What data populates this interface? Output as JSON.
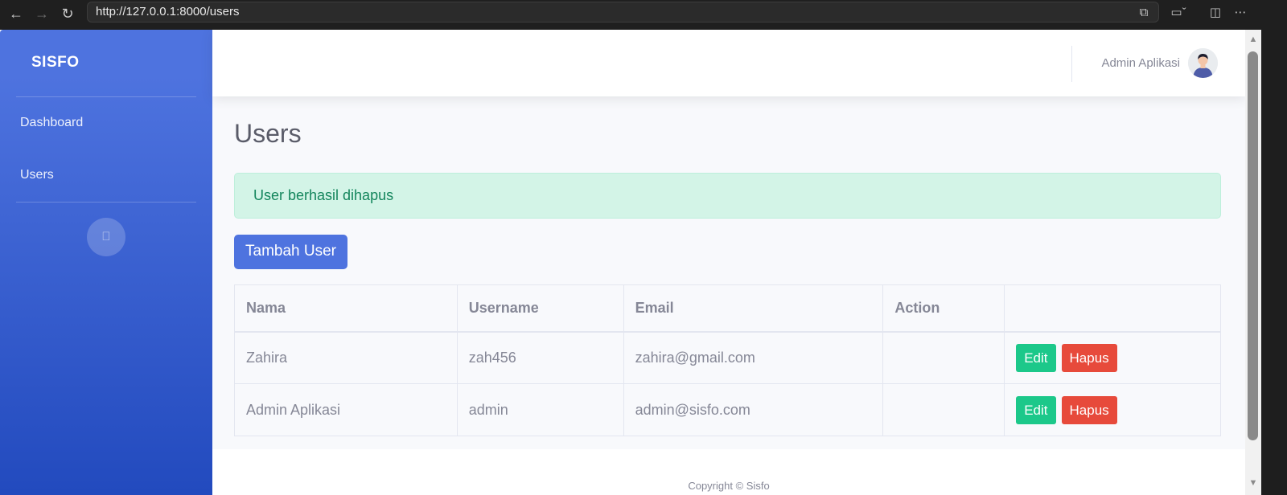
{
  "browser": {
    "url": "http://127.0.0.1:8000/users",
    "icons": {
      "back": "arrow-left-icon",
      "forward": "arrow-right-icon",
      "reload": "reload-icon",
      "tabs": "tab-actions-icon",
      "cast": "cast-icon",
      "terminal": "terminal-icon",
      "menu": "more-icon"
    }
  },
  "sidebar": {
    "brand": "SISFO",
    "items": [
      {
        "label": "Dashboard"
      },
      {
        "label": "Users"
      }
    ],
    "toggle_icon": ""
  },
  "topbar": {
    "user_name": "Admin Aplikasi"
  },
  "page": {
    "title": "Users",
    "alert": "User berhasil dihapus",
    "add_button": "Tambah User"
  },
  "table": {
    "headers": [
      "Nama",
      "Username",
      "Email",
      "Action",
      ""
    ],
    "rows": [
      {
        "nama": "Zahira",
        "username": "zah456",
        "email": "zahira@gmail.com",
        "edit": "Edit",
        "delete": "Hapus"
      },
      {
        "nama": "Admin Aplikasi",
        "username": "admin",
        "email": "admin@sisfo.com",
        "edit": "Edit",
        "delete": "Hapus"
      }
    ]
  },
  "footer": {
    "copyright": "Copyright © Sisfo"
  },
  "colors": {
    "primary": "#4e73df",
    "success": "#1cc88a",
    "danger": "#e74a3b",
    "alert_bg": "#d3f4e7",
    "alert_text": "#13855c"
  }
}
